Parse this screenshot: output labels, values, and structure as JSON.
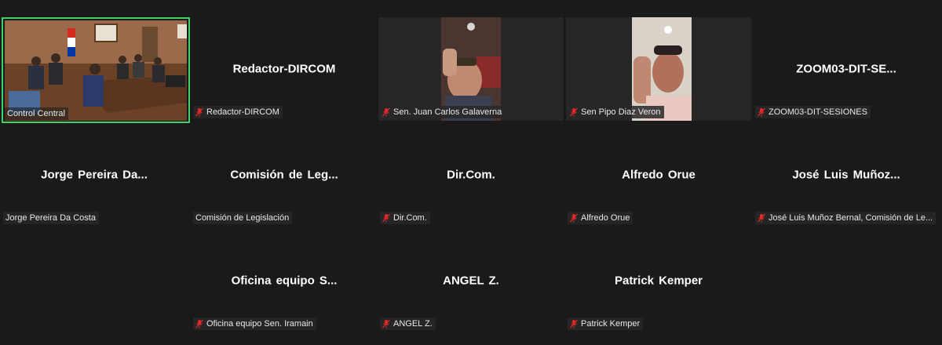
{
  "participants": [
    {
      "big_name": "",
      "tag": "Control Central",
      "muted": false,
      "video": true
    },
    {
      "big_name": "Redactor-DIRCOM",
      "tag": "Redactor-DIRCOM",
      "muted": true
    },
    {
      "big_name": "",
      "tag": "Sen. Juan Carlos Galaverna",
      "muted": true,
      "video": true
    },
    {
      "big_name": "",
      "tag": "Sen Pipo Diaz Veron",
      "muted": true,
      "video": true
    },
    {
      "big_name": "ZOOM03-DIT-SE...",
      "tag": "ZOOM03-DIT-SESIONES",
      "muted": true
    },
    {
      "big_name": "Jorge Pereira Da...",
      "tag": "Jorge Pereira Da Costa",
      "muted": false
    },
    {
      "big_name": "Comisión de Leg...",
      "tag": "Comisión de Legislación",
      "muted": false
    },
    {
      "big_name": "Dir.Com.",
      "tag": "Dir.Com.",
      "muted": true
    },
    {
      "big_name": "Alfredo Orue",
      "tag": "Alfredo Orue",
      "muted": true
    },
    {
      "big_name": "José Luis Muñoz...",
      "tag": "José Luis Muñoz Bernal, Comisión de Le...",
      "muted": true
    },
    {
      "big_name": "Oficina equipo S...",
      "tag": "Oficina equipo Sen. Iramain",
      "muted": true
    },
    {
      "big_name": "ANGEL Z.",
      "tag": "ANGEL Z.",
      "muted": true
    },
    {
      "big_name": "Patrick Kemper",
      "tag": "Patrick Kemper",
      "muted": true
    }
  ],
  "colors": {
    "active_speaker_border": "#3fd16b",
    "muted_icon": "#e02828",
    "background": "#1a1a1a"
  }
}
